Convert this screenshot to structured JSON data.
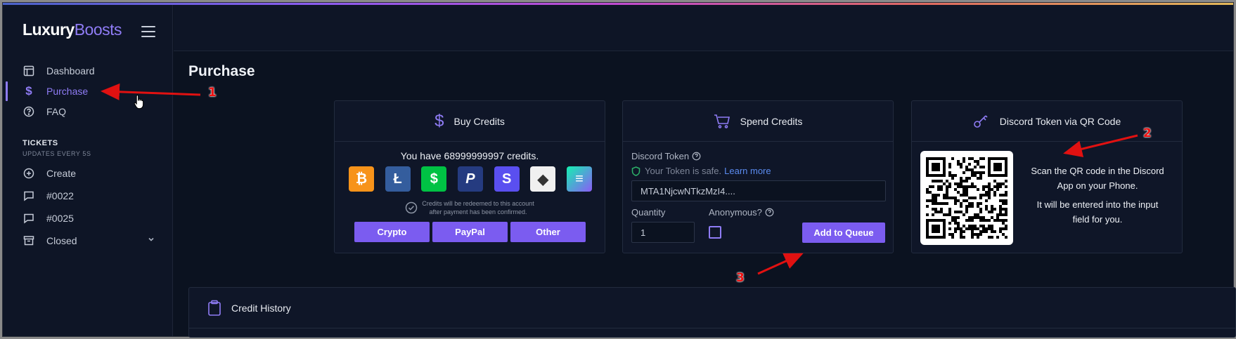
{
  "app": {
    "logo_main": "Luxury",
    "logo_accent": "Boosts"
  },
  "sidebar": {
    "items": [
      {
        "label": "Dashboard",
        "icon": "layout-icon"
      },
      {
        "label": "Purchase",
        "icon": "dollar-icon",
        "active": true
      },
      {
        "label": "FAQ",
        "icon": "help-circle-icon"
      }
    ],
    "tickets_title": "TICKETS",
    "tickets_sub": "UPDATES EVERY 5S",
    "ticket_items": [
      {
        "label": "Create",
        "icon": "plus-circle-icon"
      },
      {
        "label": "#0022",
        "icon": "message-icon"
      },
      {
        "label": "#0025",
        "icon": "message-icon"
      },
      {
        "label": "Closed",
        "icon": "archive-icon"
      }
    ]
  },
  "page": {
    "title": "Purchase"
  },
  "buy_card": {
    "title": "Buy Credits",
    "credits_text": "You have 68999999997 credits.",
    "coins": [
      {
        "name": "bitcoin",
        "glyph": "₿",
        "color": "#f7931a"
      },
      {
        "name": "litecoin",
        "glyph": "Ł",
        "color": "#345d9d"
      },
      {
        "name": "cashapp",
        "glyph": "$",
        "color": "#00c244"
      },
      {
        "name": "paypal",
        "glyph": "P",
        "color": "#253b80"
      },
      {
        "name": "sellix",
        "glyph": "S",
        "color": "#5a4ff0"
      },
      {
        "name": "ethereum",
        "glyph": "◆",
        "color": "#f0f0f0"
      },
      {
        "name": "solana",
        "glyph": "≡",
        "color": "#8b5cf6"
      }
    ],
    "note_line1": "Credits will be redeemed to this account",
    "note_line2": "after payment has been confirmed.",
    "buttons": [
      "Crypto",
      "PayPal",
      "Other"
    ]
  },
  "spend_card": {
    "title": "Spend Credits",
    "token_label": "Discord Token",
    "safe_text": "Your Token is safe.",
    "learn_more": "Learn more",
    "token_value": "MTA1NjcwNTkzMzI4....",
    "quantity_label": "Quantity",
    "quantity_value": "1",
    "anonymous_label": "Anonymous?",
    "add_button": "Add to Queue"
  },
  "qr_card": {
    "title": "Discord Token via QR Code",
    "line1": "Scan the QR code in the Discord",
    "line2": "App on your Phone.",
    "line3": "It will be entered into the input",
    "line4": "field for you."
  },
  "history": {
    "title": "Credit History"
  },
  "annotations": [
    "1",
    "2",
    "3"
  ],
  "colors": {
    "accent": "#7b5cf0",
    "background": "#0b1220",
    "annotation": "#e11111"
  }
}
